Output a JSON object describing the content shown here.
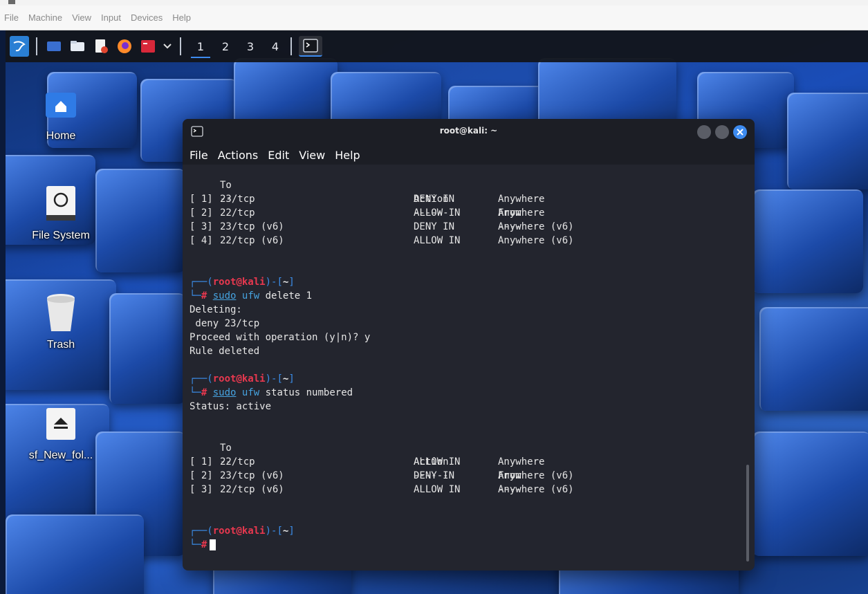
{
  "host_menu": [
    "File",
    "Machine",
    "View",
    "Input",
    "Devices",
    "Help"
  ],
  "panel": {
    "workspaces": [
      "1",
      "2",
      "3",
      "4"
    ],
    "active_workspace": "1"
  },
  "desktop_icons": [
    {
      "label": "Home",
      "icon": "home-icon"
    },
    {
      "label": "File System",
      "icon": "drive-icon"
    },
    {
      "label": "Trash",
      "icon": "trash-icon"
    },
    {
      "label": "sf_New_fol...",
      "icon": "eject-icon"
    }
  ],
  "terminal": {
    "title": "root@kali: ~",
    "menu": [
      "File",
      "Actions",
      "Edit",
      "View",
      "Help"
    ],
    "header1": {
      "to": "To",
      "action": "Action",
      "from": "From",
      "to_dash": "--",
      "action_dash": "------",
      "from_dash": "----"
    },
    "rules1": [
      {
        "num": "[ 1]",
        "to": "23/tcp",
        "action": "DENY IN",
        "from": "Anywhere"
      },
      {
        "num": "[ 2]",
        "to": "22/tcp",
        "action": "ALLOW IN",
        "from": "Anywhere"
      },
      {
        "num": "[ 3]",
        "to": "23/tcp (v6)",
        "action": "DENY IN",
        "from": "Anywhere (v6)"
      },
      {
        "num": "[ 4]",
        "to": "22/tcp (v6)",
        "action": "ALLOW IN",
        "from": "Anywhere (v6)"
      }
    ],
    "prompt": {
      "user": "root",
      "at": "@",
      "host": "kali",
      "dir": "~"
    },
    "cmd1": {
      "sudo": "sudo",
      "ufw": "ufw",
      "args": "delete 1"
    },
    "out1": [
      "Deleting:",
      " deny 23/tcp",
      "Proceed with operation (y|n)? y",
      "Rule deleted"
    ],
    "cmd2": {
      "sudo": "sudo",
      "ufw": "ufw",
      "args": "status numbered"
    },
    "out2": [
      "Status: active"
    ],
    "header2": {
      "to": "To",
      "action": "Action",
      "from": "From",
      "to_dash": "--",
      "action_dash": "------",
      "from_dash": "----"
    },
    "rules2": [
      {
        "num": "[ 1]",
        "to": "22/tcp",
        "action": "ALLOW IN",
        "from": "Anywhere"
      },
      {
        "num": "[ 2]",
        "to": "23/tcp (v6)",
        "action": "DENY IN",
        "from": "Anywhere (v6)"
      },
      {
        "num": "[ 3]",
        "to": "22/tcp (v6)",
        "action": "ALLOW IN",
        "from": "Anywhere (v6)"
      }
    ]
  },
  "colors": {
    "prompt_red": "#e8384f",
    "prompt_blue": "#3b8eea",
    "accent": "#3d8bf0"
  }
}
